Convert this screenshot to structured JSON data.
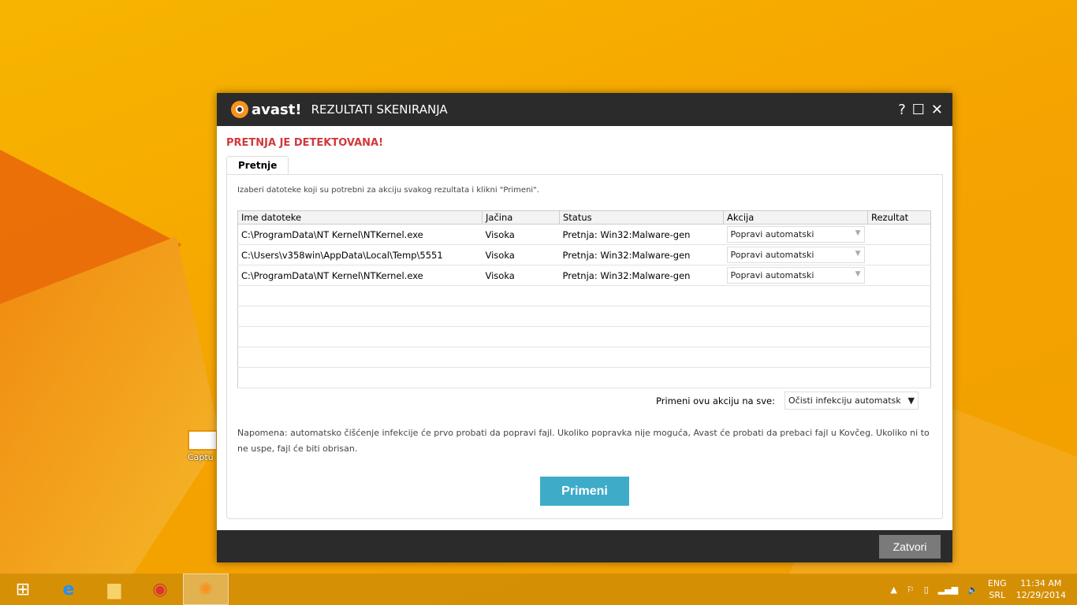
{
  "desktop": {
    "icon_label": "Captu"
  },
  "window": {
    "logo": "avast!",
    "title": "REZULTATI SKENIRANJA",
    "help": "?",
    "maximize": "☐",
    "close": "✕"
  },
  "headline": "PRETNJA JE DETEKTOVANA!",
  "tab": "Pretnje",
  "instructions": "Izaberi datoteke koji su potrebni za akciju svakog rezultata i klikni \"Primeni\".",
  "table": {
    "headers": [
      "Ime datoteke",
      "Jačina",
      "Status",
      "Akcija",
      "Rezultat"
    ],
    "rows": [
      {
        "file": "C:\\ProgramData\\NT Kernel\\NTKernel.exe",
        "severity": "Visoka",
        "status": "Pretnja: Win32:Malware-gen",
        "action": "Popravi automatski",
        "result": ""
      },
      {
        "file": "C:\\Users\\v358win\\AppData\\Local\\Temp\\5551",
        "severity": "Visoka",
        "status": "Pretnja: Win32:Malware-gen",
        "action": "Popravi automatski",
        "result": ""
      },
      {
        "file": "C:\\ProgramData\\NT Kernel\\NTKernel.exe",
        "severity": "Visoka",
        "status": "Pretnja: Win32:Malware-gen",
        "action": "Popravi automatski",
        "result": ""
      }
    ]
  },
  "apply_all": {
    "label": "Primeni ovu akciju na sve:",
    "value": "Očisti infekciju automatsk"
  },
  "note": "Napomena: automatsko čišćenje infekcije će prvo probati da popravi fajl. Ukoliko popravka nije moguća, Avast će probati da prebaci fajl u Kovčeg. Ukoliko ni to ne uspe, fajl će biti obrisan.",
  "apply_button": "Primeni",
  "close_button": "Zatvori",
  "tray": {
    "lang1": "ENG",
    "lang2": "SRL",
    "time": "11:34 AM",
    "date": "12/29/2014"
  }
}
